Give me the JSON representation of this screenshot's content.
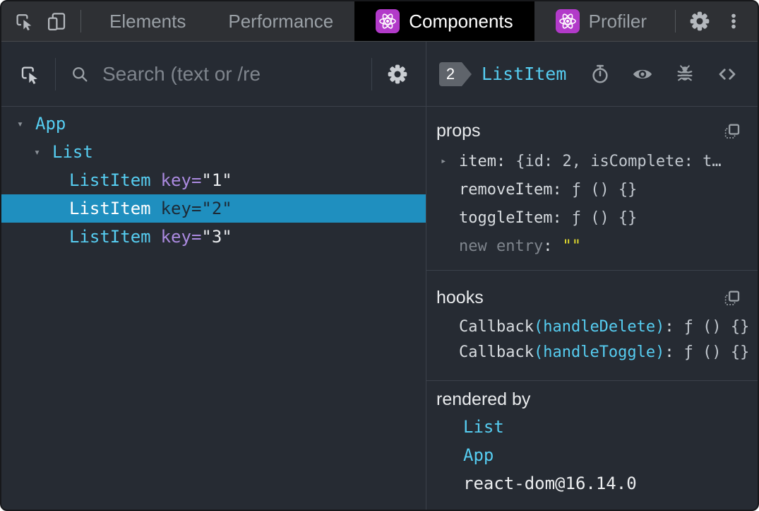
{
  "colors": {
    "panel": "#262b33",
    "topbar": "#2e3034",
    "tab_active_bg": "#000000",
    "divider": "#3b414a",
    "topbar_divider": "#46494d",
    "text": "#d8dce0",
    "text_dim": "#9aa0a6",
    "value": "#c1c7ce",
    "cyan": "#56cdf1",
    "purple": "#ab8ae0",
    "selection": "#1f8fbf",
    "selection_text": "#1d2a36",
    "yellow": "#e5de2e",
    "badge": "#5f646b",
    "react": "#b23ac9",
    "muted": "#7f858d",
    "icon_bright": "#c9cdd2",
    "white": "#ffffff"
  },
  "icons": {
    "expand_open": "▾",
    "expand_collapsed": "▸",
    "inspect": "cursor-in-box",
    "device_toolbar": "dual-screens",
    "settings": "gear",
    "menu": "kebab-dots",
    "search": "magnifier",
    "react": "atom",
    "suspense": "stopwatch",
    "inspect_dom": "eye",
    "log_data": "bug",
    "view_source": "angle-brackets",
    "copy": "copy-square"
  },
  "tabbar": {
    "tabs": [
      {
        "label": "Elements"
      },
      {
        "label": "Performance"
      },
      {
        "label": "Components"
      },
      {
        "label": "Profiler"
      }
    ]
  },
  "left_panel": {
    "search_placeholder": "Search (text or /re",
    "tree": {
      "rows": [
        {
          "name": "App"
        },
        {
          "name": "List"
        },
        {
          "name": "ListItem",
          "key_name": "key=",
          "key_value": "\"1\""
        },
        {
          "name": "ListItem",
          "key_name": "key=",
          "key_value": "\"2\"",
          "selected": true
        },
        {
          "name": "ListItem",
          "key_name": "key=",
          "key_value": "\"3\""
        }
      ]
    }
  },
  "right_panel": {
    "header": {
      "badge": "2",
      "title": "ListItem"
    },
    "props": {
      "title": "props",
      "rows": [
        {
          "name": "item",
          "value": "{id: 2, isComplete: t…"
        },
        {
          "name": "removeItem",
          "value": "ƒ () {}"
        },
        {
          "name": "toggleItem",
          "value": "ƒ () {}"
        },
        {
          "name": "new entry",
          "value": "\"\""
        }
      ]
    },
    "hooks": {
      "title": "hooks",
      "rows": [
        {
          "fn": "Callback",
          "arg": "(handleDelete)",
          "value": "ƒ () {}"
        },
        {
          "fn": "Callback",
          "arg": "(handleToggle)",
          "value": "ƒ () {}"
        }
      ]
    },
    "rendered_by": {
      "title": "rendered by",
      "items": [
        {
          "label": "List"
        },
        {
          "label": "App"
        },
        {
          "label": "react-dom@16.14.0"
        }
      ]
    }
  },
  "punct": {
    "colon": ":"
  }
}
